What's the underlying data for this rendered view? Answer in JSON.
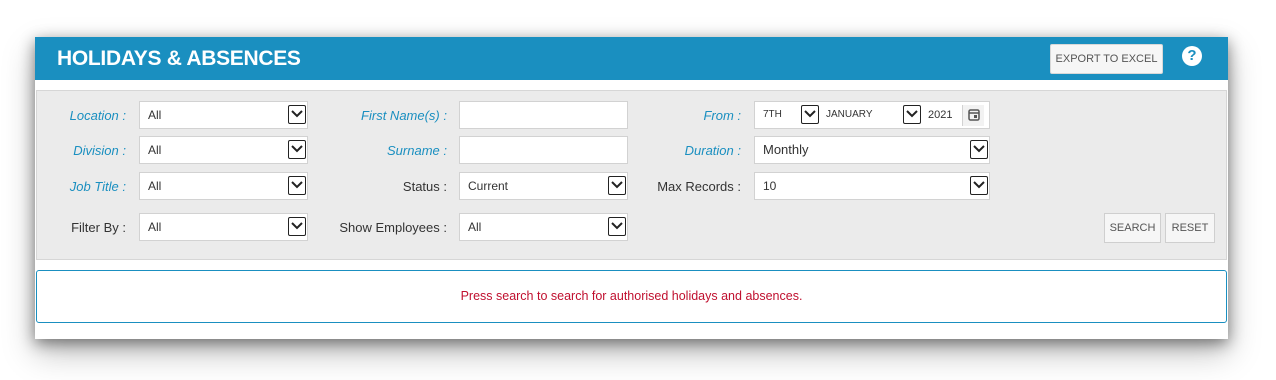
{
  "header": {
    "title": "HOLIDAYS & ABSENCES",
    "export_label": "EXPORT TO EXCEL",
    "help_glyph": "?",
    "color": "#1a8fc0"
  },
  "filters": {
    "location": {
      "label": "Location :",
      "value": "All"
    },
    "division": {
      "label": "Division :",
      "value": "All"
    },
    "job_title": {
      "label": "Job Title :",
      "value": "All"
    },
    "filter_by": {
      "label": "Filter By :",
      "value": "All"
    },
    "first_names": {
      "label": "First Name(s) :",
      "value": ""
    },
    "surname": {
      "label": "Surname :",
      "value": ""
    },
    "status": {
      "label": "Status :",
      "value": "Current"
    },
    "show_employees": {
      "label": "Show Employees :",
      "value": "All"
    },
    "from": {
      "label": "From :",
      "day": "7TH",
      "month": "JANUARY",
      "year": "2021"
    },
    "duration": {
      "label": "Duration :",
      "value": "Monthly"
    },
    "max_records": {
      "label": "Max Records :",
      "value": "10"
    }
  },
  "buttons": {
    "search": "SEARCH",
    "reset": "RESET"
  },
  "message": "Press search to search for authorised holidays and absences."
}
